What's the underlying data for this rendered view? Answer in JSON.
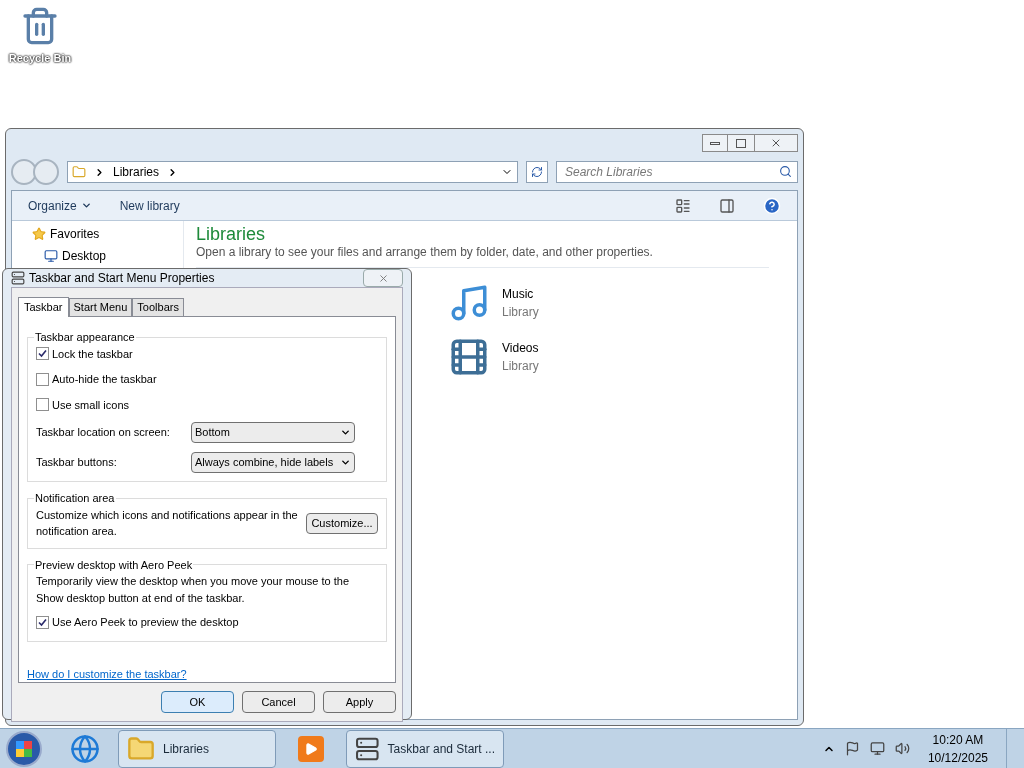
{
  "desktop_icons": [
    {
      "label": "Recycle Bin"
    }
  ],
  "explorer": {
    "breadcrumb": [
      "Libraries"
    ],
    "search": {
      "placeholder": "Search Libraries"
    },
    "toolbar": [
      {
        "label": "Organize",
        "kind": "menu"
      },
      {
        "label": "New library",
        "kind": "plain"
      }
    ],
    "sidebar": [
      {
        "label": "Favorites",
        "children": [
          {
            "label": "Desktop"
          }
        ]
      }
    ],
    "heading": "Libraries",
    "description": "Open a library to see your files and arrange them by folder, date, and other properties.",
    "libraries": [
      {
        "name": "Music",
        "type": "Library",
        "kind": "music"
      },
      {
        "name": "Videos",
        "type": "Library",
        "kind": "video"
      }
    ]
  },
  "dialog": {
    "title": "Taskbar and Start Menu Properties",
    "tabs": [
      {
        "label": "Taskbar",
        "selected": true
      },
      {
        "label": "Start Menu",
        "selected": false
      },
      {
        "label": "Toolbars",
        "selected": false
      }
    ],
    "appearance": {
      "legend": "Taskbar appearance",
      "options": [
        {
          "label": "Lock the taskbar",
          "checked": true
        },
        {
          "label": "Auto-hide the taskbar",
          "checked": false
        },
        {
          "label": "Use small icons",
          "checked": false
        }
      ],
      "dropdowns": [
        {
          "label": "Taskbar location on screen:",
          "value": "Bottom"
        },
        {
          "label": "Taskbar buttons:",
          "value": "Always combine, hide labels"
        }
      ]
    },
    "notification": {
      "legend": "Notification area",
      "text": "Customize which icons and notifications appear in the notification area.",
      "button": "Customize..."
    },
    "peek": {
      "legend": "Preview desktop with Aero Peek",
      "text": "Temporarily view the desktop when you move your mouse to the Show desktop button at end of the taskbar.",
      "option": {
        "label": "Use Aero Peek to preview the desktop",
        "checked": true
      }
    },
    "help_link": "How do I customize the taskbar?",
    "buttons": [
      {
        "label": "OK",
        "default": true
      },
      {
        "label": "Cancel",
        "default": false
      },
      {
        "label": "Apply",
        "default": false
      }
    ]
  },
  "taskbar": {
    "buttons": [
      {
        "label": "Libraries",
        "kind": "folder"
      },
      {
        "label": "Taskbar and Start ...",
        "kind": "properties"
      }
    ],
    "time": "10:20 AM",
    "date": "10/12/2025"
  }
}
